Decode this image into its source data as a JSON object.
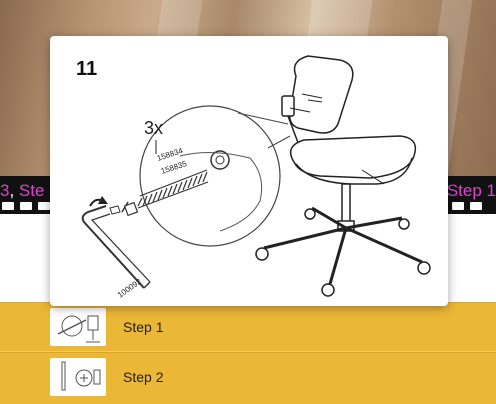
{
  "modal": {
    "step_number": "11",
    "quantity": "3x",
    "part_numbers": [
      "158834",
      "158835"
    ],
    "tool_number": "100092"
  },
  "filmstrip": {
    "left_text_number": "3",
    "left_text_sep": ", ",
    "left_text_word": "Ste",
    "right_text": "Step 1"
  },
  "steps": [
    {
      "label": "Step 1"
    },
    {
      "label": "Step 2"
    }
  ]
}
